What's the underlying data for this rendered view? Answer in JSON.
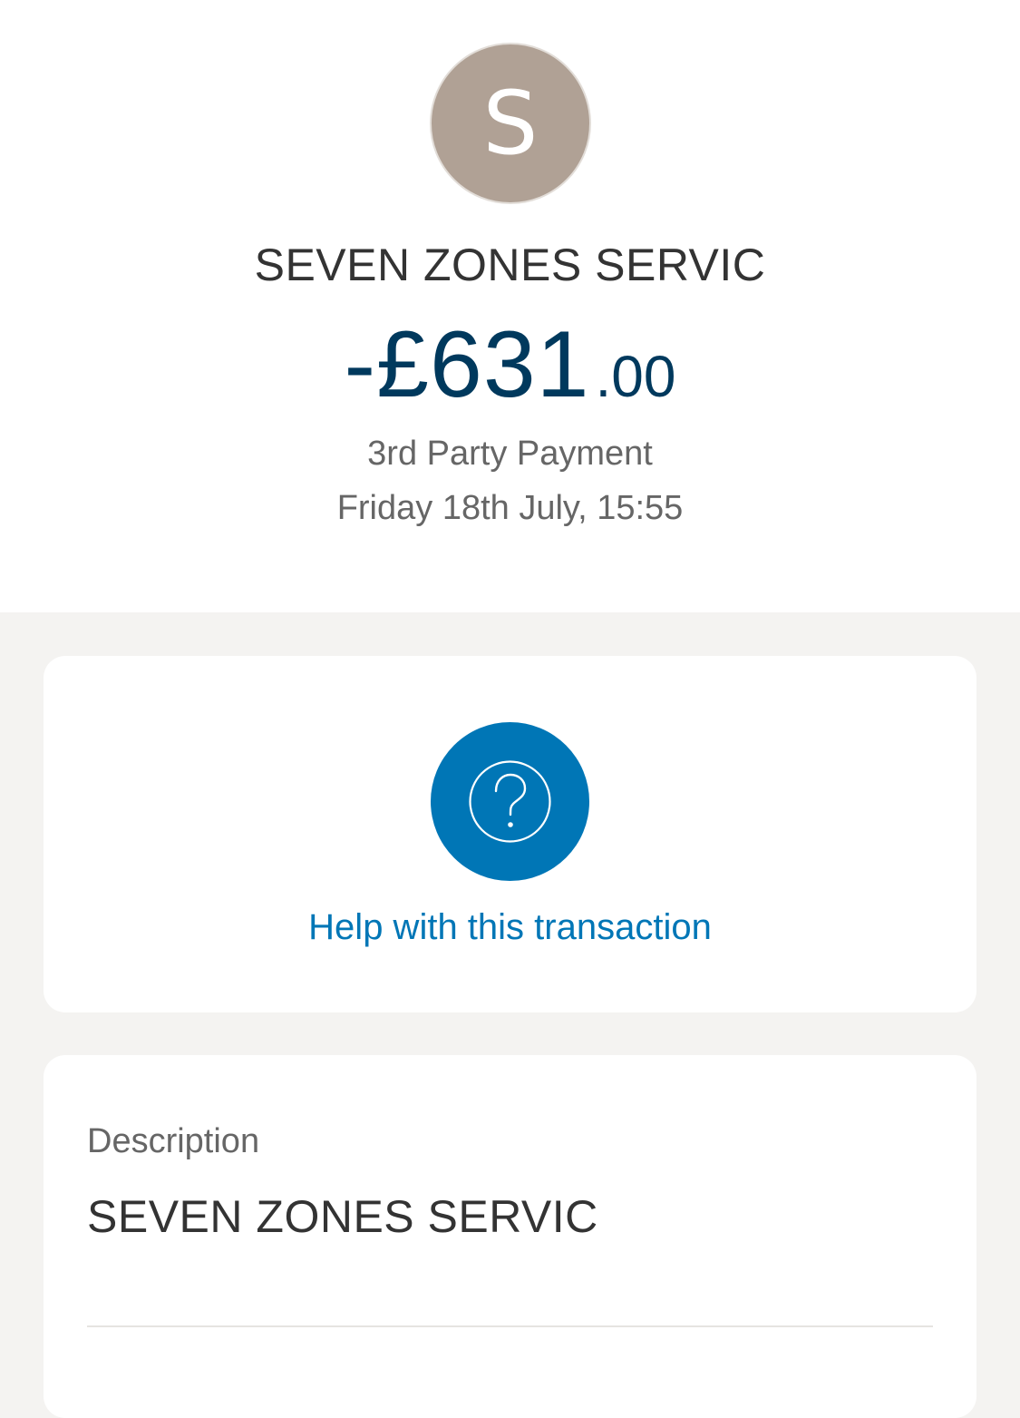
{
  "header": {
    "avatar_initial": "S",
    "merchant_name": "SEVEN ZONES SERVIC",
    "amount_major": "-£631",
    "amount_minor": ".00",
    "transaction_type": "3rd Party Payment",
    "transaction_datetime": "Friday 18th July, 15:55"
  },
  "help": {
    "icon": "question-circle-icon",
    "label": "Help with this transaction"
  },
  "details": {
    "description_label": "Description",
    "description_value": "SEVEN ZONES SERVIC"
  },
  "colors": {
    "avatar_bg": "#b0a195",
    "amount": "#00395d",
    "accent_blue": "#0076b6",
    "page_bg": "#f4f3f1"
  }
}
